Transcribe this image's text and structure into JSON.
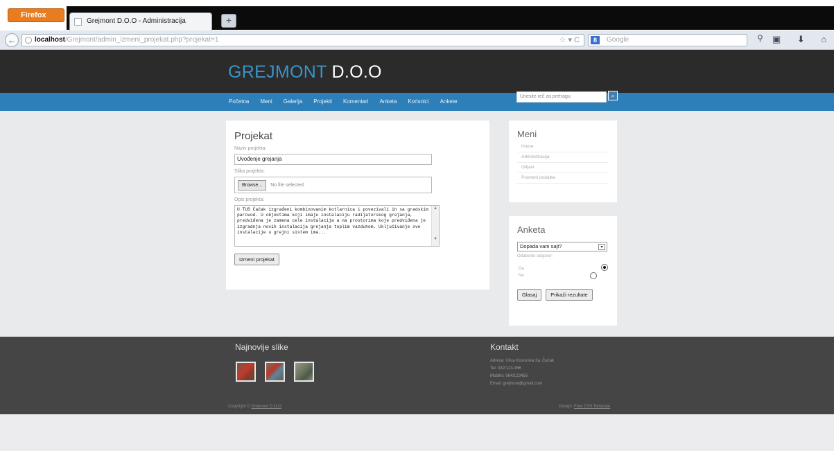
{
  "browser": {
    "menu_button": "Firefox",
    "tab_title": "Grejmont D.O.O - Administracija",
    "new_tab": "+",
    "back": "←",
    "url_host": "localhost",
    "url_path": "/Grejmont/admin_izmeni_projekat.php?projekat=1",
    "url_tools": "☆ ▾ C",
    "search_engine": "Google",
    "search_glass": "⚲",
    "nav_icons": "▣ ⬇ ⌂"
  },
  "site": {
    "logo_part1": "GREJMONT ",
    "logo_part2": "D.O.O",
    "menu": [
      "Početna",
      "Meni",
      "Galerija",
      "Projekti",
      "Komentari",
      "Anketa",
      "Korisnici",
      "Ankete"
    ],
    "search_placeholder": "Unesite reč za pretragu",
    "search_btn": "⌕"
  },
  "project_form": {
    "title": "Projekat",
    "name_label": "Naziv projekta:",
    "name_value": "Uvođenje grejanja",
    "image_label": "Slika projekta:",
    "browse_label": "Browse...",
    "no_file_label": "No file selected.",
    "text_label": "Opis projekta:",
    "text_value": "U TUS Čačak izgrađeni kombinovanim kotlarnica i povezivali ih sa gradskim parovod. U objektima koji imaju instalaciju radijatorskog grejanja, predviđena je zamena cele instalacija a na prostorima koje predviđena je izgradnja novih instalacija grejanja toplim vazduhom. Uključivanje ove instalacije u grejni sistem ima...",
    "scroll_up": "▲",
    "scroll_down": "▼",
    "save_label": "Izmeni projekat"
  },
  "meni": {
    "title": "Meni",
    "items": [
      "Home",
      "Administracija",
      "Odjavi",
      "Promeni podatke"
    ]
  },
  "anketa": {
    "title": "Anketa",
    "question": "Dopada vam sajt?",
    "select_arrow": "▾",
    "sub_label": "Odaberite odgovor:",
    "opt_yes": "Da",
    "opt_no": "Ne",
    "vote_label": "Glasaj",
    "results_label": "Prikaži rezultate"
  },
  "footer": {
    "slike_title": "Najnovije slike",
    "kontakt_title": "Kontakt",
    "kontakt_lines": [
      "Adresa: Ulica Kosovska 3a, Čačak",
      "Tel: 032/123-456",
      "Mobilni: 064/123456",
      "Email: grejmont@gmail.com"
    ],
    "copyright_text": "Copyright © ",
    "copyright_link": "Grejmont D.O.O",
    "design_text": "Design: ",
    "design_link": "Free CSS Template"
  }
}
